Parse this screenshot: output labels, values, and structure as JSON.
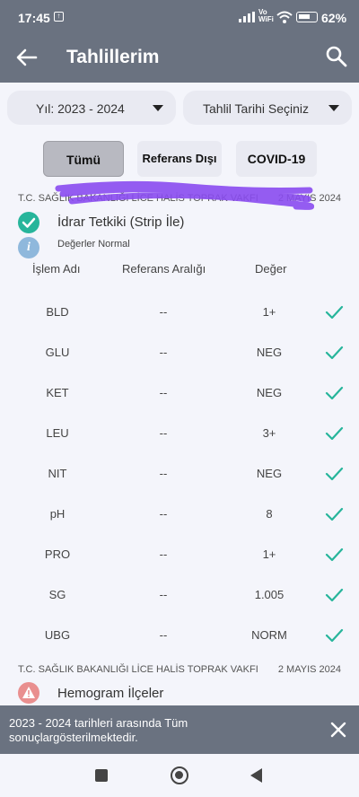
{
  "statusbar": {
    "time": "17:45",
    "battery": "62%",
    "volte_top": "Vo",
    "volte_bottom": "WiFi"
  },
  "header": {
    "title": "Tahlillerim"
  },
  "filters": {
    "year_dropdown": "Yıl: 2023 - 2024",
    "date_dropdown": "Tahlil Tarihi Seçiniz",
    "chips": [
      "Tümü",
      "Referans Dışı",
      "COVID-19"
    ],
    "selected": "Tümü"
  },
  "results": [
    {
      "institution": "T.C. SAĞLIK BAKANLIĞI LİCE HALİS TOPRAK VAKFI",
      "date": "2 MAYIS 2024",
      "test_name": "İdrar Tetkiki (Strip İle)",
      "status_text": "Değerler Normal",
      "columns": [
        "İşlem Adı",
        "Referans Aralığı",
        "Değer"
      ],
      "rows": [
        {
          "name": "BLD",
          "ref": "--",
          "value": "1+"
        },
        {
          "name": "GLU",
          "ref": "--",
          "value": "NEG"
        },
        {
          "name": "KET",
          "ref": "--",
          "value": "NEG"
        },
        {
          "name": "LEU",
          "ref": "--",
          "value": "3+"
        },
        {
          "name": "NIT",
          "ref": "--",
          "value": "NEG"
        },
        {
          "name": "pH",
          "ref": "--",
          "value": "8"
        },
        {
          "name": "PRO",
          "ref": "--",
          "value": "1+"
        },
        {
          "name": "SG",
          "ref": "--",
          "value": "1.005"
        },
        {
          "name": "UBG",
          "ref": "--",
          "value": "NORM"
        }
      ]
    },
    {
      "institution": "T.C. SAĞLIK BAKANLIĞI LİCE HALİS TOPRAK VAKFI",
      "date": "2 MAYIS 2024",
      "test_name": "Hemogram İlçeler"
    }
  ],
  "toast": {
    "message": "2023 - 2024 tarihleri arasında Tüm sonuçlargösterilmektedir."
  },
  "colors": {
    "header": "#6a7280",
    "check": "#27b59b",
    "info": "#8fb8dc",
    "warning": "#e98f8f"
  },
  "icons": [
    "back-arrow-icon",
    "search-icon",
    "check-circle-icon",
    "info-icon",
    "warning-icon",
    "check-icon",
    "close-icon"
  ]
}
